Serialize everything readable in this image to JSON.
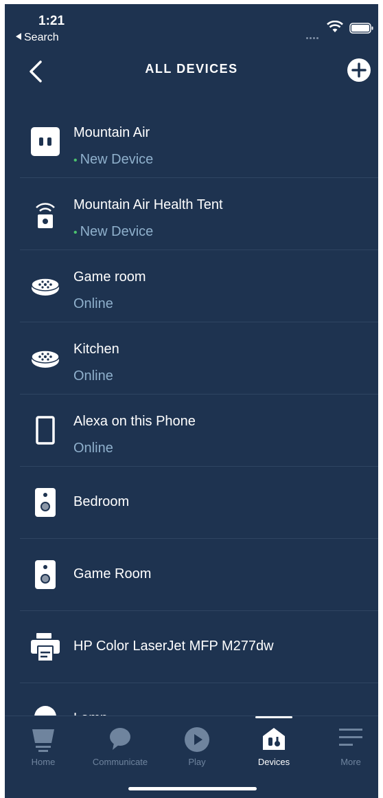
{
  "status_bar": {
    "time": "1:21",
    "back_app": "Search"
  },
  "header": {
    "title": "ALL DEVICES",
    "back_icon": "chevron-left-icon",
    "add_icon": "plus-circle-icon"
  },
  "devices": [
    {
      "name": "Mountain Air",
      "status": "New Device",
      "status_dot": true,
      "icon": "smart-plug-icon"
    },
    {
      "name": "Mountain Air Health Tent",
      "status": "New Device",
      "status_dot": true,
      "icon": "wifi-device-icon"
    },
    {
      "name": "Game room",
      "status": "Online",
      "icon": "echo-dot-icon"
    },
    {
      "name": "Kitchen",
      "status": "Online",
      "icon": "echo-dot-icon"
    },
    {
      "name": "Alexa on this Phone",
      "status": "Online",
      "icon": "phone-icon"
    },
    {
      "name": "Bedroom",
      "icon": "speaker-icon"
    },
    {
      "name": "Game Room",
      "icon": "speaker-icon"
    },
    {
      "name": "HP Color LaserJet MFP M277dw",
      "icon": "printer-icon"
    },
    {
      "name": "Lamp",
      "icon": "bulb-icon"
    }
  ],
  "tabs": [
    {
      "label": "Home",
      "icon": "home-echo-icon",
      "active": false
    },
    {
      "label": "Communicate",
      "icon": "chat-bubble-icon",
      "active": false
    },
    {
      "label": "Play",
      "icon": "play-icon",
      "active": false
    },
    {
      "label": "Devices",
      "icon": "devices-house-icon",
      "active": true
    },
    {
      "label": "More",
      "icon": "menu-lines-icon",
      "active": false
    }
  ],
  "colors": {
    "background": "#1e3350",
    "status_dot": "#4cc36e",
    "secondary_text": "#8fb0cc",
    "inactive_tab": "#6f849e"
  }
}
